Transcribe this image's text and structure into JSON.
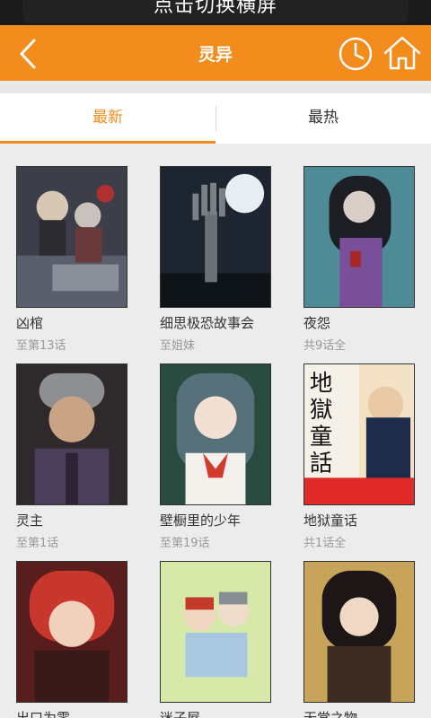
{
  "status_banner": {
    "text": "点击切换横屏"
  },
  "header": {
    "title": "灵异",
    "back_icon": "back-arrow-icon",
    "history_icon": "clock-icon",
    "home_icon": "home-icon",
    "color": "#f28c1c"
  },
  "tabs": [
    {
      "label": "最新",
      "active": true
    },
    {
      "label": "最热",
      "active": false
    }
  ],
  "comics": [
    {
      "title": "凶棺",
      "status": "至第13话"
    },
    {
      "title": "细思极恐故事会",
      "status": "至姐妹"
    },
    {
      "title": "夜怨",
      "status": "共9话全"
    },
    {
      "title": "灵主",
      "status": "至第1话"
    },
    {
      "title": "壁橱里的少年",
      "status": "至第19话"
    },
    {
      "title": "地狱童话",
      "status": "共1话全"
    },
    {
      "title": "出口为零",
      "status": ""
    },
    {
      "title": "迷子屋",
      "status": ""
    },
    {
      "title": "无常之物",
      "status": ""
    }
  ]
}
